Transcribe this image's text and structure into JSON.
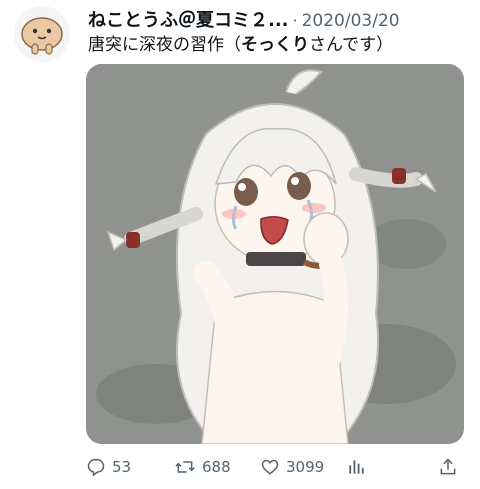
{
  "tweet": {
    "author_name": "ねことうふ＠夏コミ２...",
    "separator": "·",
    "date": "2020/03/20",
    "text_before": "唐突に深夜の習作（",
    "text_bold": "そっくり",
    "text_after": "さんです）"
  },
  "actions": {
    "replies": "53",
    "retweets": "688",
    "likes": "3099"
  },
  "icons": [
    "reply-icon",
    "retweet-icon",
    "like-icon",
    "analytics-icon",
    "share-icon"
  ],
  "colors": {
    "text": "#0f1419",
    "muted": "#536471",
    "media_background": "#8f928e"
  }
}
